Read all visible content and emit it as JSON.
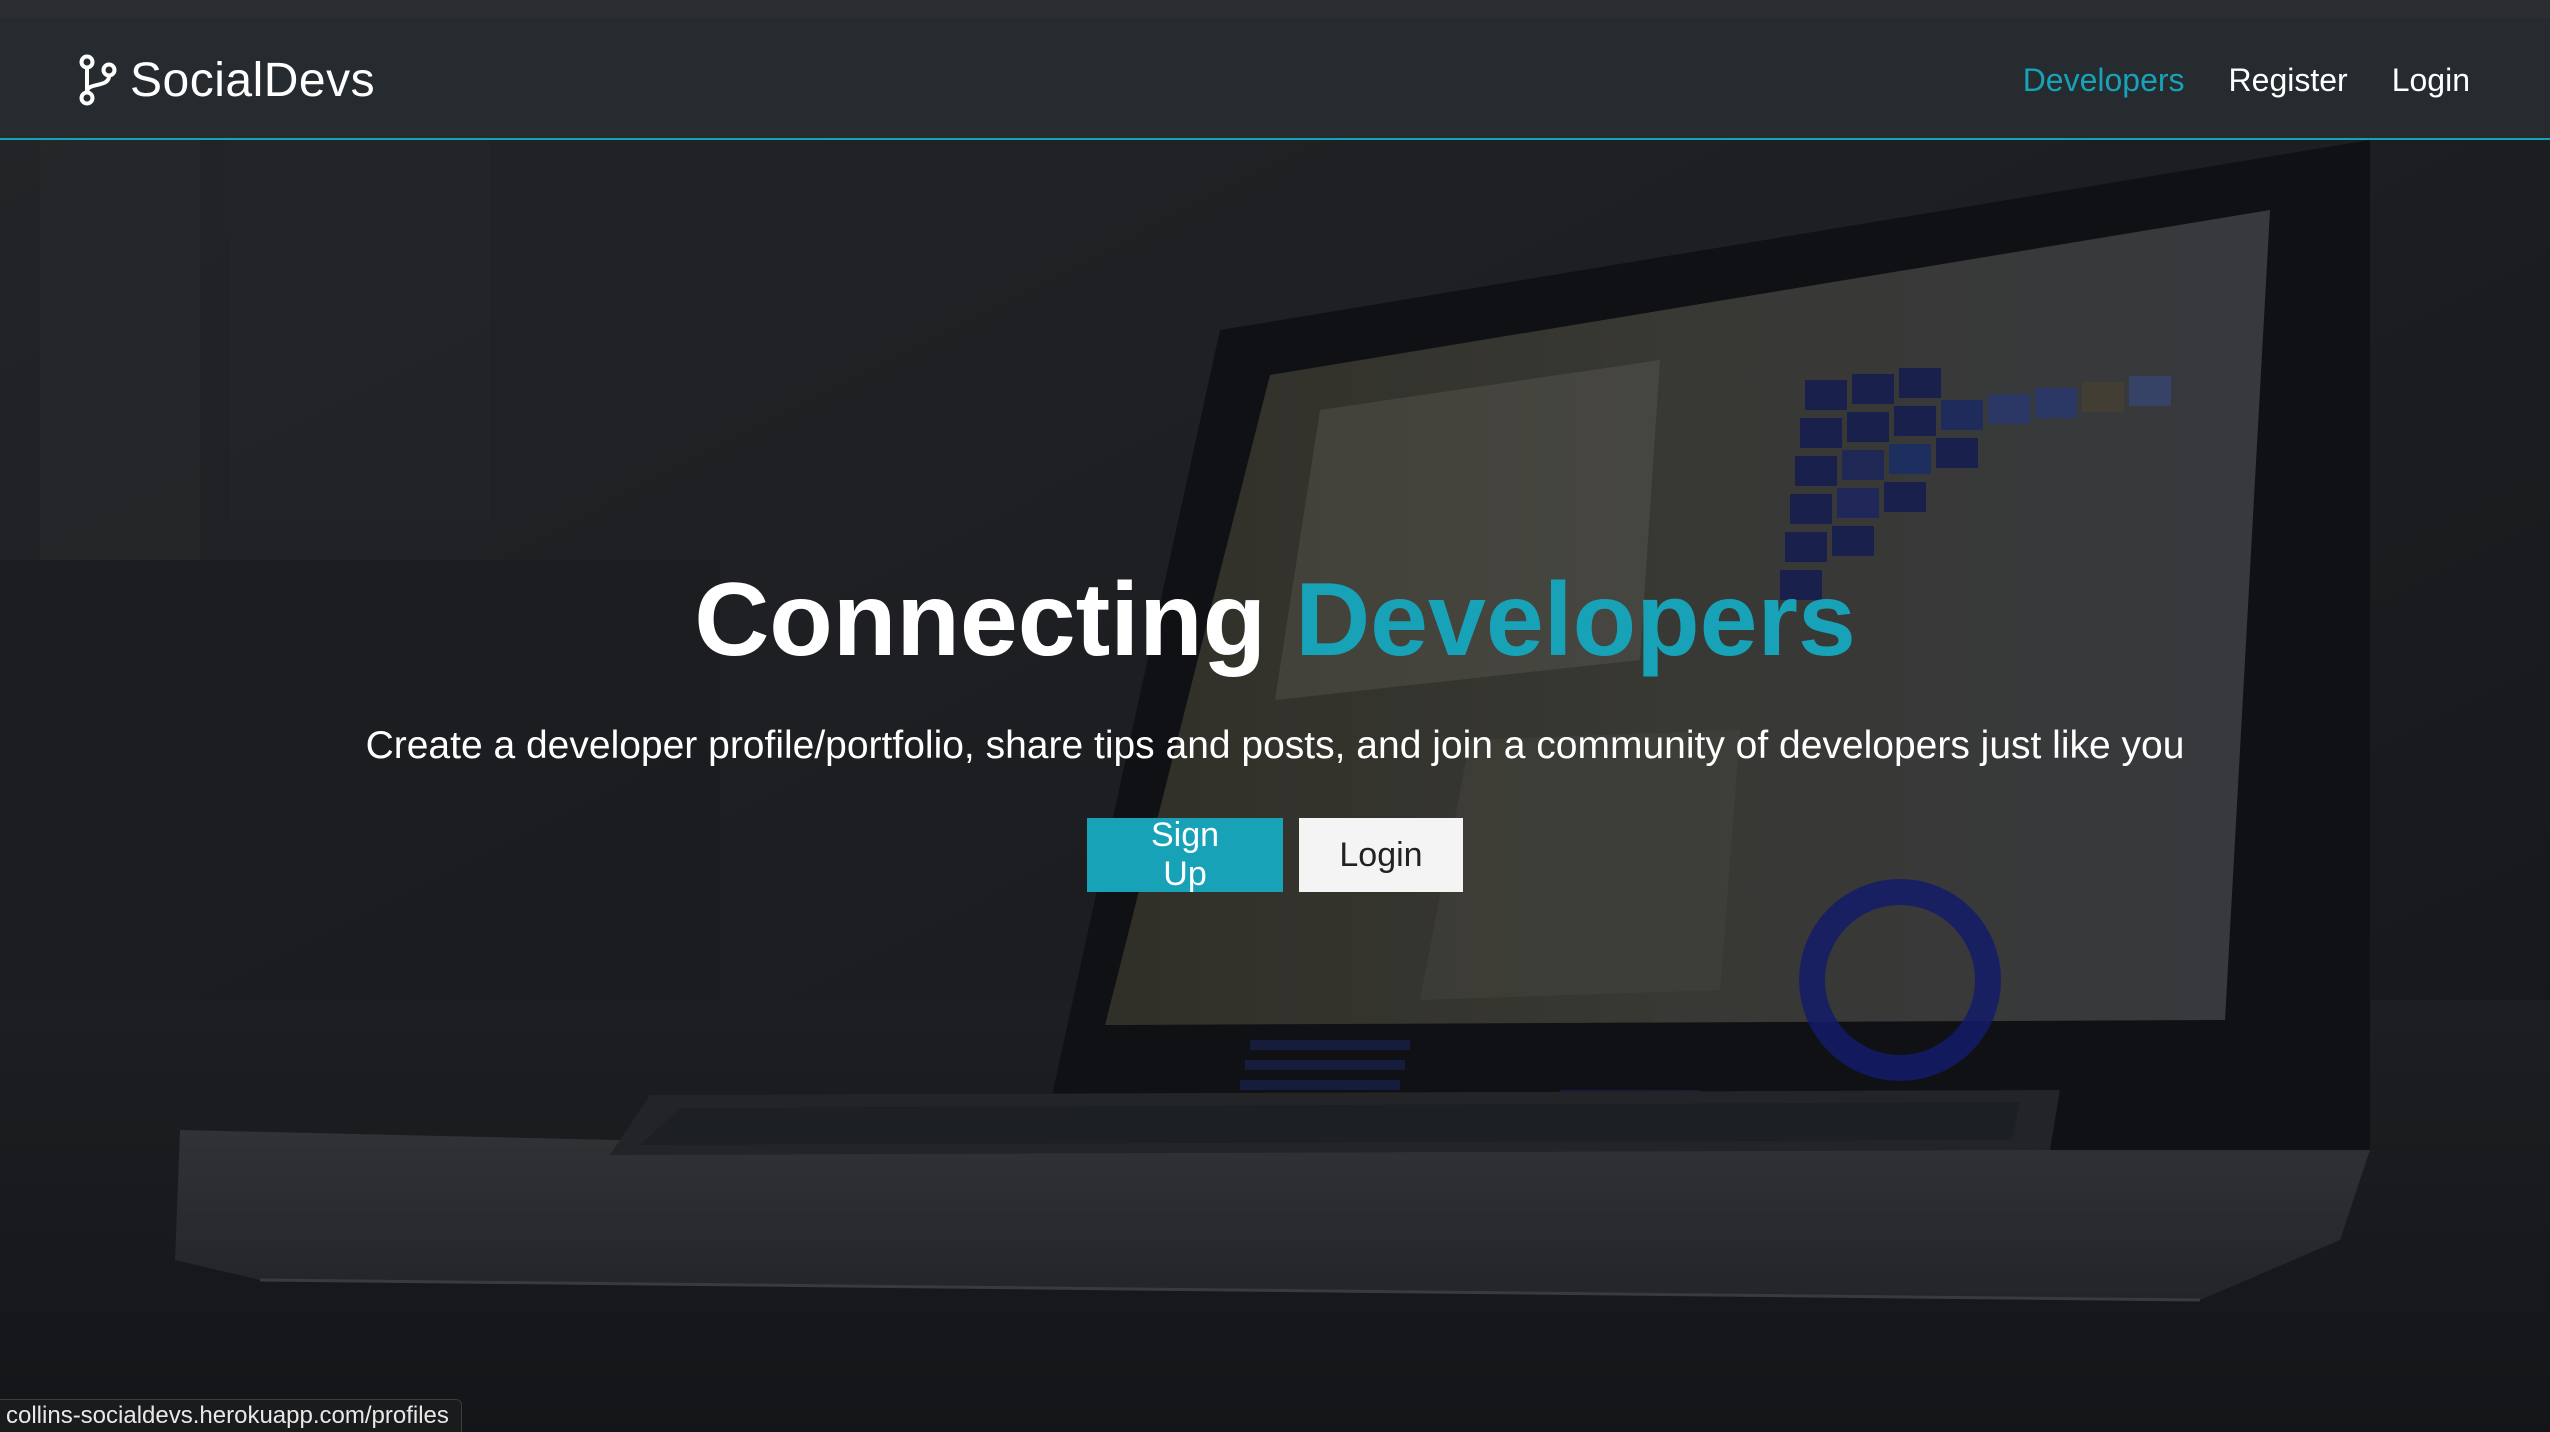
{
  "brand": {
    "name": "SocialDevs",
    "icon": "code-branch-icon"
  },
  "nav": {
    "links": [
      {
        "label": "Developers",
        "active": true
      },
      {
        "label": "Register",
        "active": false
      },
      {
        "label": "Login",
        "active": false
      }
    ]
  },
  "hero": {
    "title_part1": "Connecting",
    "title_part2": "Developers",
    "subtitle": "Create a developer profile/portfolio, share tips and posts, and join a community of developers just like you",
    "signup_label": "Sign Up",
    "login_label": "Login"
  },
  "status_bar": {
    "url": "collins-socialdevs.herokuapp.com/profiles"
  },
  "colors": {
    "accent": "#17a2b8",
    "navbar_bg": "#262b30",
    "text": "#ffffff"
  }
}
